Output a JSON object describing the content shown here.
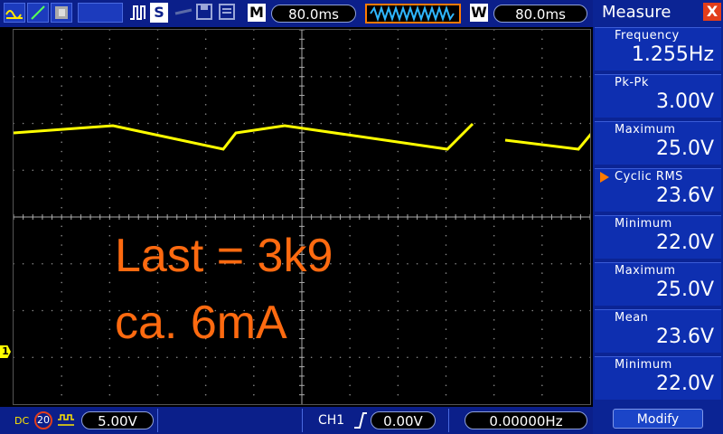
{
  "toolbar": {
    "m_label": "M",
    "time_base": "80.0ms",
    "w_label": "W",
    "window_time": "80.0ms",
    "s_label": "S",
    "icons": [
      "waveform-icon",
      "cursor-icon",
      "display-icon",
      "trigger-icon",
      "save-icon",
      "save-disk-icon",
      "print-icon"
    ]
  },
  "panel": {
    "title": "Measure",
    "close": "X",
    "measurements": [
      {
        "label": "Frequency",
        "value": "1.255Hz"
      },
      {
        "label": "Pk-Pk",
        "value": "3.00V"
      },
      {
        "label": "Maximum",
        "value": "25.0V"
      },
      {
        "label": "Cyclic RMS",
        "value": "23.6V",
        "selected": true
      },
      {
        "label": "Minimum",
        "value": "22.0V"
      },
      {
        "label": "Maximum",
        "value": "25.0V"
      },
      {
        "label": "Mean",
        "value": "23.6V"
      },
      {
        "label": "Minimum",
        "value": "22.0V"
      }
    ],
    "modify": "Modify"
  },
  "bottom": {
    "coupling": "DC",
    "bw_limit": "20",
    "volts_div": "5.00V",
    "channel": "CH1",
    "trigger_level": "0.00V",
    "frequency": "0.00000Hz"
  },
  "plot": {
    "channel_marker": "1",
    "annotation_line1": "Last = 3k9",
    "annotation_line2": "ca. 6mA",
    "trace_color": "#ffff00",
    "annotation_color": "#ff6a10"
  }
}
